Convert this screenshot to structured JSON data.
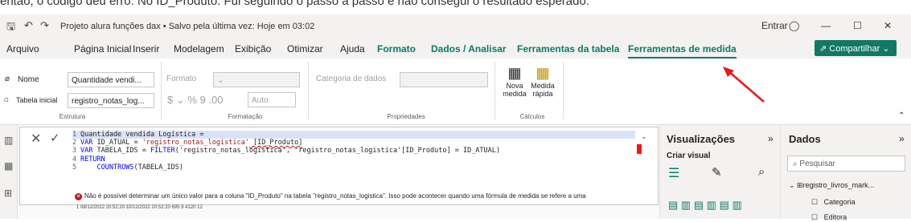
{
  "intro_text": "então, o código deu erro. No ID_Produto. Fui seguindo o passo a passo e não consegui o resultado esperado.",
  "titlebar": {
    "title": "Projeto alura funções dax • Salvo pela última vez: Hoje em 03:02",
    "signin": "Entrar"
  },
  "menu": [
    "Arquivo",
    "Página Inicial",
    "Inserir",
    "Modelagem",
    "Exibição",
    "Otimizar",
    "Ajuda",
    "Formato",
    "Dados / Analisar",
    "Ferramentas da tabela",
    "Ferramentas de medida"
  ],
  "share_label": "Compartilhar",
  "ribbon": {
    "nome_label": "Nome",
    "nome_value": "Quantidade vendi...",
    "tabela_label": "Tabela inicial",
    "tabela_value": "registro_notas_log...",
    "estrutura": "Estrutura",
    "formato_label": "Formato",
    "auto_label": "Auto",
    "formatacao": "Formatação",
    "categoria_label": "Categoria de dados",
    "propriedades": "Propriedades",
    "nova_medida_1": "Nova",
    "nova_medida_2": "medida",
    "medida_rapida_1": "Medida",
    "medida_rapida_2": "rápida",
    "calculos": "Cálculos"
  },
  "code": {
    "l1": "Quantidade vendida Logística =",
    "l2a": "VAR",
    "l2b": " ID_ATUAL = ",
    "l2c": "'registro_notas_logistica'",
    "l2d": " [ID_Produto]",
    "l3a": "VAR",
    "l3b": " TABELA_IDS = ",
    "l3c": "FILTER",
    "l3d": "('registro_notas_logistica', 'registro_notas_logistica'[ID_Produto] = ID_ATUAL)",
    "l4": "RETURN",
    "l5a": "COUNTROWS",
    "l5b": "(TABELA_IDS)"
  },
  "error_msg": "Não é possível determinar um único valor para a coluna \"ID_Produto\" na tabela \"registro_notas_logistica\". Isso pode acontecer quando uma fórmula de medida se refere a uma",
  "rows_line": "1 08/12/2022 20:52:20   10/12/2022 20:52:20          695                                                9            4120           12",
  "visual": {
    "title": "Visualizações",
    "sub": "Criar visual"
  },
  "dados": {
    "title": "Dados",
    "search_placeholder": "Pesquisar",
    "table": "registro_livros_mark...",
    "field1": "Categoria",
    "field2": "Editora"
  }
}
